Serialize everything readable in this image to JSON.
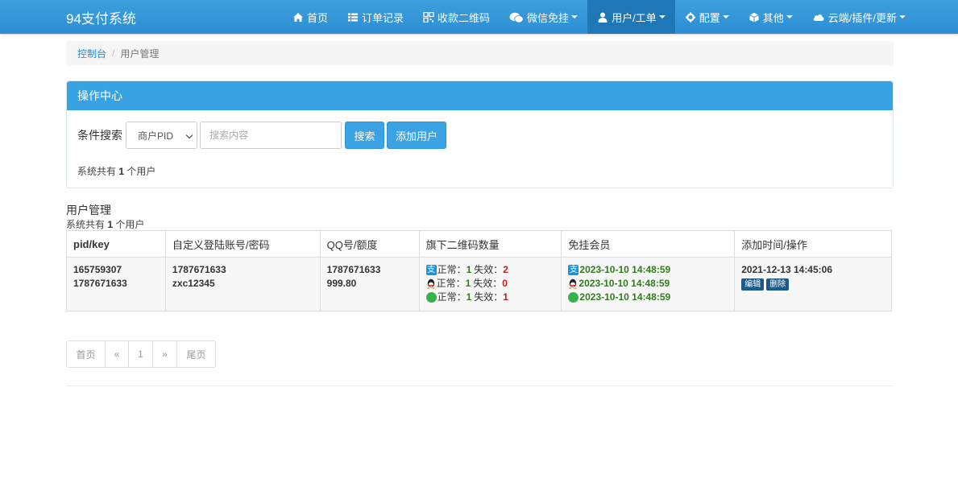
{
  "app": {
    "title": "94支付系统"
  },
  "nav": [
    {
      "label": "首页",
      "icon": "home-icon",
      "has_caret": false,
      "active": false
    },
    {
      "label": "订单记录",
      "icon": "list-icon",
      "has_caret": false,
      "active": false
    },
    {
      "label": "收款二维码",
      "icon": "qrcode-icon",
      "has_caret": false,
      "active": false
    },
    {
      "label": "微信免挂",
      "icon": "wechat-icon",
      "has_caret": true,
      "active": false
    },
    {
      "label": "用户/工单",
      "icon": "user-icon",
      "has_caret": true,
      "active": true
    },
    {
      "label": "配置",
      "icon": "gear-icon",
      "has_caret": true,
      "active": false
    },
    {
      "label": "其他",
      "icon": "cube-icon",
      "has_caret": true,
      "active": false
    },
    {
      "label": "云端/插件/更新",
      "icon": "cloud-icon",
      "has_caret": true,
      "active": false
    }
  ],
  "breadcrumb": {
    "home": "控制台",
    "current": "用户管理"
  },
  "panel": {
    "title": "操作中心",
    "search_label": "条件搜索",
    "select_value": "商户PID",
    "search_placeholder": "搜索内容",
    "search_button": "搜索",
    "add_button": "添加用户",
    "count_prefix": "系统共有",
    "count": "1",
    "count_suffix": "个用户"
  },
  "section": {
    "title": "用户管理",
    "count_prefix": "系统共有",
    "count": "1",
    "count_suffix": "个用户"
  },
  "table": {
    "headers": [
      "pid/key",
      "自定义登陆账号/密码",
      "QQ号/额度",
      "旗下二维码数量",
      "免挂会员",
      "添加时间/操作"
    ],
    "rows": [
      {
        "pid": "165759307",
        "key": "1787671633",
        "account": "1787671633",
        "password": "zxc12345",
        "qq": "1787671633",
        "quota": "999.80",
        "qr": [
          {
            "icon": "alipay-icon",
            "normal_label": "正常：",
            "normal": "1",
            "fail_label": "失效：",
            "fail": "2"
          },
          {
            "icon": "qq-icon",
            "normal_label": "正常：",
            "normal": "1",
            "fail_label": "失效：",
            "fail": "0"
          },
          {
            "icon": "wechat-icon",
            "normal_label": "正常：",
            "normal": "1",
            "fail_label": "失效：",
            "fail": "1"
          }
        ],
        "vip": [
          {
            "icon": "alipay-icon",
            "time": "2023-10-10 14:48:59"
          },
          {
            "icon": "qq-icon",
            "time": "2023-10-10 14:48:59"
          },
          {
            "icon": "wechat-icon",
            "time": "2023-10-10 14:48:59"
          }
        ],
        "added": "2021-12-13 14:45:06",
        "edit_label": "编辑",
        "delete_label": "删除"
      }
    ]
  },
  "pager": {
    "first": "首页",
    "prev": "«",
    "page": "1",
    "next": "»",
    "last": "尾页"
  },
  "colors": {
    "nav": "#2d8fd2",
    "nav_active": "#1e78b8",
    "accent": "#38a3e3",
    "ok": "#2e7d1a",
    "fail": "#cc1a1a"
  }
}
